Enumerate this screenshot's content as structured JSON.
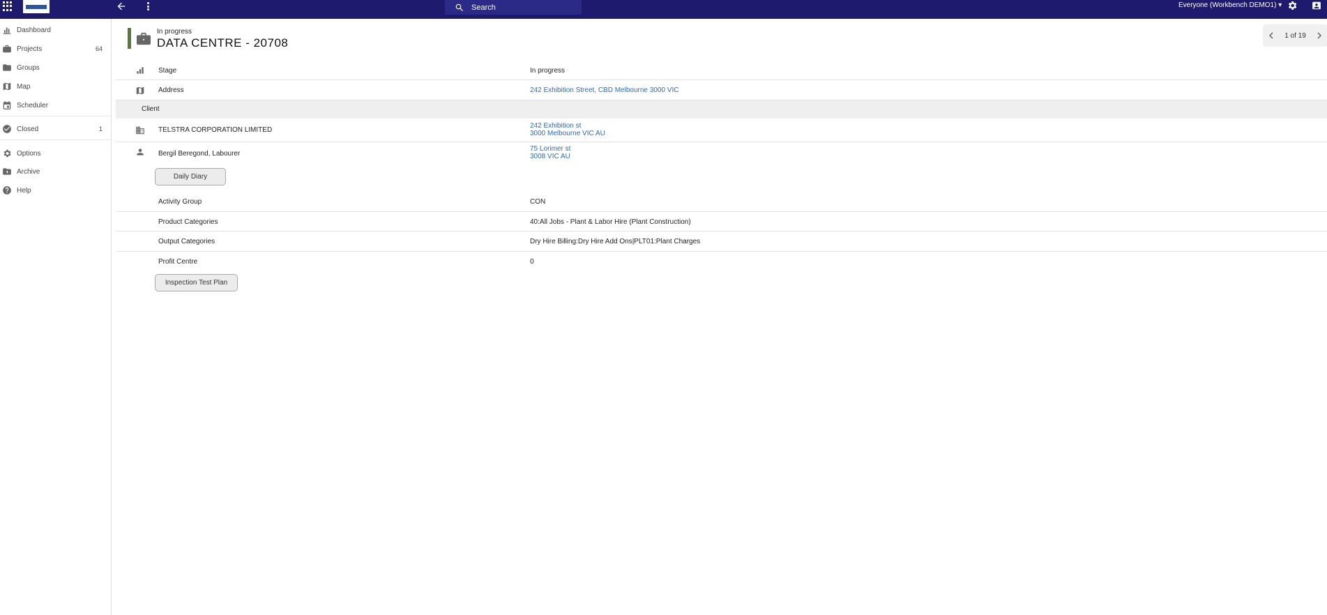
{
  "topbar": {
    "search_placeholder": "Search",
    "workspace": "Everyone (Workbench DEMO1)"
  },
  "sidebar": {
    "items": [
      {
        "label": "Dashboard",
        "icon": "chart-icon",
        "count": ""
      },
      {
        "label": "Projects",
        "icon": "briefcase-icon",
        "count": "64"
      },
      {
        "label": "Groups",
        "icon": "folder-icon",
        "count": ""
      },
      {
        "label": "Map",
        "icon": "map-icon",
        "count": ""
      },
      {
        "label": "Scheduler",
        "icon": "calendar-icon",
        "count": ""
      },
      {
        "label": "Closed",
        "icon": "check-circle-icon",
        "count": "1"
      },
      {
        "label": "Options",
        "icon": "gear-icon",
        "count": ""
      },
      {
        "label": "Archive",
        "icon": "archive-icon",
        "count": ""
      },
      {
        "label": "Help",
        "icon": "help-icon",
        "count": ""
      }
    ]
  },
  "header": {
    "status": "In progress",
    "title": "DATA CENTRE - 20708",
    "status_color": "#5a7a3a"
  },
  "pager": {
    "text": "1 of 19"
  },
  "details": {
    "stage": {
      "label": "Stage",
      "value": "In progress"
    },
    "address": {
      "label": "Address",
      "value": "242 Exhibition Street, CBD Melbourne 3000 VIC"
    },
    "client_section": "Client",
    "client": {
      "label": "TELSTRA CORPORATION LIMITED",
      "line1": "242 Exhibition st",
      "line2": "3000 Melbourne VIC AU"
    },
    "contact": {
      "label": "Bergil Beregond, Labourer",
      "line1": "75 Lorimer st",
      "line2": "3008 VIC AU"
    },
    "daily_diary_button": "Daily Diary",
    "activity_group": {
      "label": "Activity Group",
      "value": "CON"
    },
    "product_categories": {
      "label": "Product Categories",
      "value": "40:All Jobs - Plant & Labor Hire (Plant Construction)"
    },
    "output_categories": {
      "label": "Output Categories",
      "value": "Dry Hire Billing:Dry Hire Add Ons|PLT01:Plant Charges"
    },
    "profit_centre": {
      "label": "Profit Centre",
      "value": "0"
    },
    "inspection_button": "Inspection Test Plan"
  },
  "colors": {
    "topbar": "#1e1b6f",
    "link": "#2a6bb8"
  }
}
